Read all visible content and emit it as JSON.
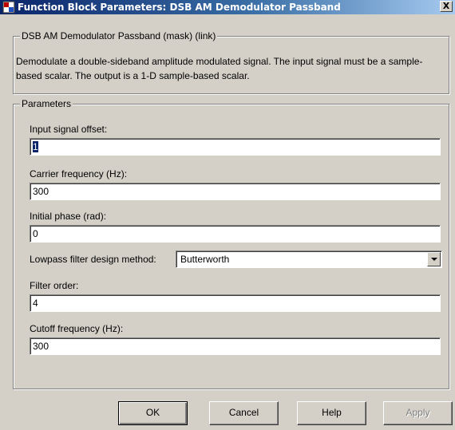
{
  "window": {
    "title": "Function Block Parameters: DSB AM Demodulator Passband",
    "close_label": "X"
  },
  "mask": {
    "group_label": "DSB AM Demodulator Passband (mask) (link)",
    "description": "Demodulate a double-sideband amplitude modulated signal. The input signal must be a sample-based scalar. The output is a 1-D sample-based scalar."
  },
  "parameters": {
    "group_label": "Parameters",
    "input_offset": {
      "label": "Input signal offset:",
      "value": "1"
    },
    "carrier_freq": {
      "label": "Carrier frequency (Hz):",
      "value": "300"
    },
    "initial_phase": {
      "label": "Initial phase (rad):",
      "value": "0"
    },
    "filter_method": {
      "label": "Lowpass filter design method:",
      "value": "Butterworth"
    },
    "filter_order": {
      "label": "Filter order:",
      "value": "4"
    },
    "cutoff_freq": {
      "label": "Cutoff frequency (Hz):",
      "value": "300"
    }
  },
  "buttons": {
    "ok": "OK",
    "cancel": "Cancel",
    "help": "Help",
    "apply": "Apply"
  },
  "icons": {
    "title": "simulink-block-icon",
    "close": "close-icon",
    "dropdown": "chevron-down-icon"
  }
}
